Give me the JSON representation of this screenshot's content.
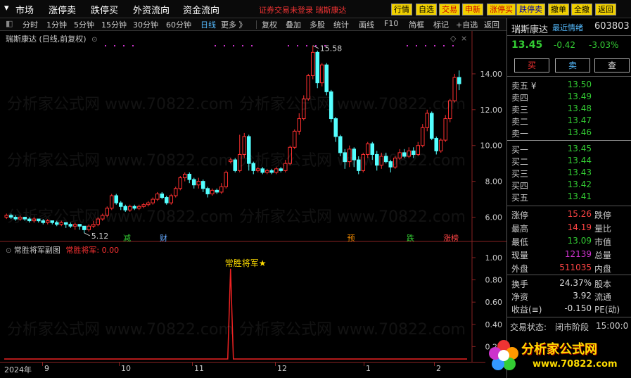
{
  "topbar": {
    "menus": [
      "市场",
      "涨停卖",
      "跌停买",
      "外资流向",
      "资金流向"
    ],
    "notice": "证券交易未登录  瑞斯康达",
    "buttons": [
      {
        "label": "行情",
        "bg": "#f0d000",
        "fg": "#000"
      },
      {
        "label": "自选",
        "bg": "#f0d000",
        "fg": "#000"
      },
      {
        "label": "交易",
        "bg": "#f0d000",
        "fg": "#c00"
      },
      {
        "label": "申新",
        "bg": "#f0d000",
        "fg": "#c00"
      },
      {
        "label": "涨停买",
        "bg": "#f0d000",
        "fg": "#c00"
      },
      {
        "label": "跌停卖",
        "bg": "#f0d000",
        "fg": "#00a"
      },
      {
        "label": "撤单",
        "bg": "#f0d000",
        "fg": "#000"
      },
      {
        "label": "全撤",
        "bg": "#f0d000",
        "fg": "#000"
      },
      {
        "label": "返回",
        "bg": "#f0d000",
        "fg": "#000"
      }
    ]
  },
  "toolbar": {
    "periods": [
      "分时",
      "1分钟",
      "5分钟",
      "15分钟",
      "30分钟",
      "60分钟",
      "日线",
      "更多 》"
    ],
    "active": "日线",
    "tools": [
      "复权",
      "叠加",
      "多股",
      "统计",
      "画线",
      "F10",
      "简框",
      "标记",
      "+自选",
      "返回"
    ]
  },
  "chart_title": "瑞斯康达 (日线,前复权)",
  "chart_data": {
    "type": "candlestick",
    "ylim": [
      5,
      16
    ],
    "yticks": [
      "14.00",
      "12.00",
      "10.00",
      "8.00",
      "6.00"
    ],
    "ytick_values": [
      14,
      12,
      10,
      8,
      6
    ],
    "high_label": "15.58",
    "low_label": "5.12",
    "colors": {
      "up": "#ff3030",
      "down": "#54ffff"
    },
    "candles": [
      [
        6.0,
        6.1,
        5.9,
        6.2
      ],
      [
        6.1,
        6.0,
        5.9,
        6.2
      ],
      [
        6.0,
        5.9,
        5.8,
        6.1
      ],
      [
        5.9,
        6.0,
        5.8,
        6.1
      ],
      [
        6.0,
        5.9,
        5.8,
        6.0
      ],
      [
        5.9,
        5.8,
        5.7,
        6.0
      ],
      [
        5.8,
        5.9,
        5.7,
        6.0
      ],
      [
        5.9,
        5.8,
        5.7,
        5.9
      ],
      [
        5.8,
        5.7,
        5.6,
        5.9
      ],
      [
        5.7,
        5.8,
        5.6,
        5.9
      ],
      [
        5.8,
        5.7,
        5.6,
        5.8
      ],
      [
        5.7,
        5.6,
        5.5,
        5.8
      ],
      [
        5.6,
        5.7,
        5.5,
        5.8
      ],
      [
        5.7,
        5.6,
        5.4,
        5.7
      ],
      [
        5.6,
        5.5,
        5.4,
        5.7
      ],
      [
        5.5,
        5.6,
        5.3,
        5.7
      ],
      [
        5.6,
        5.5,
        5.3,
        5.6
      ],
      [
        5.5,
        5.3,
        5.12,
        5.5
      ],
      [
        5.3,
        5.5,
        5.2,
        5.6
      ],
      [
        5.5,
        5.6,
        5.4,
        5.8
      ],
      [
        5.6,
        5.9,
        5.5,
        6.0
      ],
      [
        5.9,
        6.1,
        5.8,
        6.2
      ],
      [
        6.1,
        6.5,
        6.0,
        6.6
      ],
      [
        6.5,
        7.2,
        6.4,
        7.3
      ],
      [
        7.2,
        6.8,
        6.7,
        7.3
      ],
      [
        6.8,
        6.6,
        6.4,
        6.9
      ],
      [
        6.6,
        6.4,
        6.3,
        6.7
      ],
      [
        6.4,
        6.6,
        6.3,
        6.7
      ],
      [
        6.6,
        6.5,
        6.4,
        6.7
      ],
      [
        6.5,
        6.6,
        6.4,
        6.7
      ],
      [
        6.6,
        6.7,
        6.5,
        6.8
      ],
      [
        6.7,
        6.8,
        6.6,
        6.9
      ],
      [
        6.8,
        7.0,
        6.7,
        7.1
      ],
      [
        7.0,
        7.3,
        6.9,
        7.4
      ],
      [
        7.3,
        7.1,
        7.0,
        7.4
      ],
      [
        7.1,
        6.8,
        6.7,
        7.2
      ],
      [
        6.8,
        7.2,
        6.7,
        7.3
      ],
      [
        7.2,
        7.6,
        7.1,
        7.7
      ],
      [
        7.6,
        8.2,
        7.5,
        8.3
      ],
      [
        8.2,
        8.4,
        8.0,
        8.5
      ],
      [
        8.4,
        8.1,
        7.9,
        8.5
      ],
      [
        8.1,
        7.8,
        7.6,
        8.2
      ],
      [
        7.8,
        8.0,
        7.6,
        8.2
      ],
      [
        8.0,
        7.6,
        7.4,
        8.1
      ],
      [
        7.6,
        7.3,
        7.1,
        7.7
      ],
      [
        7.3,
        7.5,
        7.2,
        7.6
      ],
      [
        7.5,
        7.4,
        7.3,
        7.6
      ],
      [
        7.4,
        7.7,
        7.3,
        7.9
      ],
      [
        7.7,
        8.5,
        7.6,
        8.6
      ],
      [
        9.1,
        9.2,
        9.0,
        9.3
      ],
      [
        9.2,
        8.6,
        8.5,
        9.3
      ],
      [
        8.6,
        9.5,
        8.5,
        10.6
      ],
      [
        9.5,
        10.5,
        9.3,
        10.7
      ],
      [
        10.5,
        9.0,
        8.6,
        10.6
      ],
      [
        9.0,
        8.6,
        8.4,
        9.1
      ],
      [
        8.6,
        8.7,
        8.5,
        8.8
      ],
      [
        8.7,
        8.5,
        8.4,
        8.8
      ],
      [
        8.5,
        8.6,
        8.4,
        8.7
      ],
      [
        8.6,
        8.5,
        8.4,
        8.7
      ],
      [
        8.5,
        8.7,
        8.4,
        8.8
      ],
      [
        8.7,
        8.6,
        8.5,
        8.8
      ],
      [
        8.6,
        9.0,
        8.5,
        9.2
      ],
      [
        9.0,
        9.9,
        8.9,
        10.0
      ],
      [
        9.9,
        10.8,
        9.8,
        10.9
      ],
      [
        10.8,
        11.5,
        10.6,
        11.8
      ],
      [
        11.5,
        12.6,
        11.4,
        12.8
      ],
      [
        12.6,
        13.9,
        12.5,
        14.0
      ],
      [
        13.9,
        15.2,
        13.7,
        15.58
      ],
      [
        15.2,
        13.5,
        13.2,
        15.3
      ],
      [
        13.5,
        14.5,
        13.3,
        14.6
      ],
      [
        14.5,
        13.0,
        12.8,
        14.6
      ],
      [
        13.0,
        11.5,
        11.3,
        13.1
      ],
      [
        11.5,
        10.5,
        10.2,
        11.6
      ],
      [
        10.5,
        9.6,
        9.4,
        10.6
      ],
      [
        9.6,
        9.1,
        8.7,
        9.8
      ],
      [
        9.1,
        9.8,
        8.8,
        10.0
      ],
      [
        9.8,
        9.2,
        8.8,
        9.9
      ],
      [
        9.2,
        8.6,
        8.4,
        9.4
      ],
      [
        8.6,
        9.5,
        8.5,
        9.6
      ],
      [
        9.5,
        10.1,
        9.3,
        10.2
      ],
      [
        10.1,
        9.5,
        9.2,
        10.2
      ],
      [
        9.5,
        8.9,
        8.6,
        9.7
      ],
      [
        8.9,
        9.4,
        8.7,
        9.6
      ],
      [
        9.4,
        9.1,
        9.0,
        9.6
      ],
      [
        9.1,
        8.8,
        8.5,
        9.2
      ],
      [
        8.8,
        9.3,
        8.7,
        9.4
      ],
      [
        9.3,
        9.6,
        9.2,
        9.8
      ],
      [
        9.6,
        9.4,
        9.3,
        9.8
      ],
      [
        9.4,
        9.7,
        9.3,
        9.9
      ],
      [
        9.7,
        9.5,
        9.3,
        9.9
      ],
      [
        9.5,
        10.0,
        9.4,
        10.2
      ],
      [
        10.0,
        11.0,
        9.9,
        11.2
      ],
      [
        11.0,
        11.8,
        10.8,
        12.0
      ],
      [
        11.8,
        10.4,
        10.3,
        11.9
      ],
      [
        10.4,
        9.7,
        9.5,
        10.5
      ],
      [
        9.7,
        10.3,
        9.6,
        10.4
      ],
      [
        10.3,
        11.5,
        10.2,
        11.7
      ],
      [
        11.5,
        12.5,
        11.3,
        12.6
      ],
      [
        12.5,
        13.8,
        12.4,
        14.0
      ],
      [
        13.8,
        13.45,
        13.09,
        14.19
      ]
    ],
    "markers": [
      {
        "text": "减",
        "color": "#3c3",
        "idx": 26
      },
      {
        "text": "财",
        "color": "#6af",
        "idx": 34
      },
      {
        "text": "预",
        "color": "#e80",
        "idx": 75
      },
      {
        "text": "跌",
        "color": "#3c3",
        "idx": 88
      },
      {
        "text": "涨榜",
        "color": "#f44",
        "idx": 96
      }
    ]
  },
  "subchart": {
    "title": "常胜将军副图",
    "value_label": "常胜将军: 0.00",
    "signal_label": "常胜将军★",
    "yticks": [
      "1.00",
      "0.80",
      "0.60",
      "0.40",
      "0.20"
    ],
    "ytick_values": [
      1,
      0.8,
      0.6,
      0.4,
      0.2
    ],
    "signal_idx": 49,
    "signal_value": 0.9
  },
  "timeaxis": {
    "labels": [
      "2024年",
      "9",
      "10",
      "11",
      "12",
      "1",
      "2"
    ]
  },
  "quote": {
    "name": "瑞斯康达",
    "tag": "最近情绪",
    "code": "603803",
    "price": "13.45",
    "change": "-0.42",
    "pct": "-3.03%",
    "buy": "买",
    "sell": "卖",
    "query": "查",
    "asks": [
      {
        "label": "卖五 ¥",
        "price": "13.50"
      },
      {
        "label": "卖四",
        "price": "13.49"
      },
      {
        "label": "卖三",
        "price": "13.48"
      },
      {
        "label": "卖二",
        "price": "13.47"
      },
      {
        "label": "卖一",
        "price": "13.46"
      }
    ],
    "bids": [
      {
        "label": "买一",
        "price": "13.45"
      },
      {
        "label": "买二",
        "price": "13.44"
      },
      {
        "label": "买三",
        "price": "13.43"
      },
      {
        "label": "买四",
        "price": "13.42"
      },
      {
        "label": "买五",
        "price": "13.41"
      }
    ],
    "stats": [
      {
        "l1": "涨停",
        "v1": "15.26",
        "c1": "red",
        "l2": "跌停"
      },
      {
        "l1": "最高",
        "v1": "14.19",
        "c1": "red",
        "l2": "量比"
      },
      {
        "l1": "最低",
        "v1": "13.09",
        "c1": "grn",
        "l2": "市值"
      },
      {
        "l1": "现量",
        "v1": "12139",
        "c1": "mag",
        "l2": "总量"
      },
      {
        "l1": "外盘",
        "v1": "511035",
        "c1": "red",
        "l2": "内盘"
      }
    ],
    "stats2": [
      {
        "l1": "换手",
        "v1": "24.37%",
        "l2": "股本"
      },
      {
        "l1": "净资",
        "v1": "3.92",
        "l2": "流通"
      },
      {
        "l1": "收益(≡)",
        "v1": "-0.150",
        "l2": "PE(动)"
      }
    ],
    "status_label": "交易状态:",
    "status_value": "闭市阶段",
    "status_time": "15:00:0"
  },
  "watermark": "分析家公式网 www.70822.com",
  "logo": {
    "text": "分析家公式网",
    "url": "www.70822.com"
  }
}
